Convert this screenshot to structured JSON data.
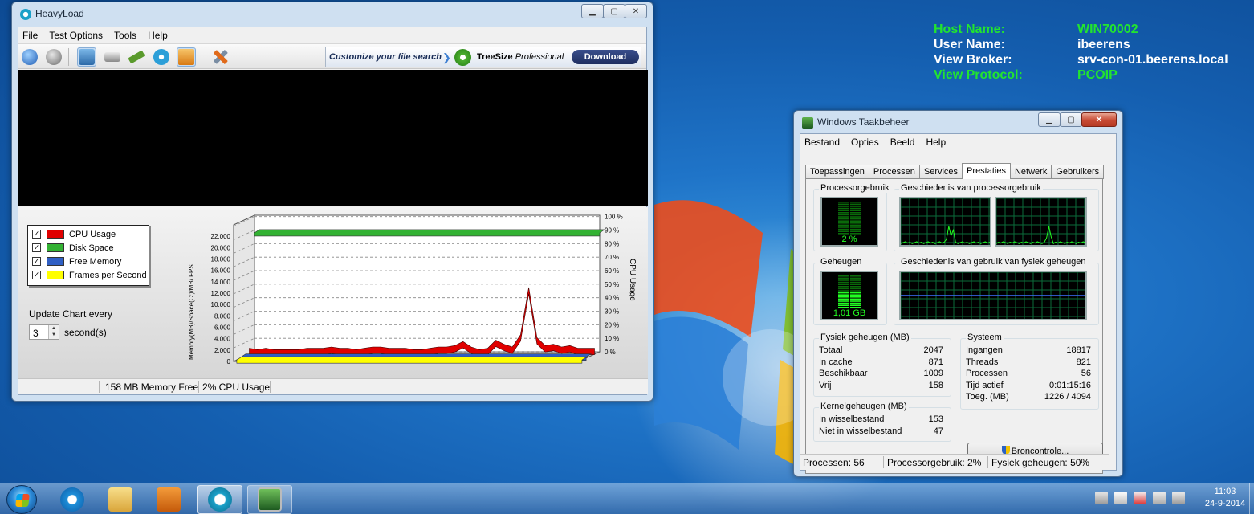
{
  "desktop": {
    "bginfo": [
      {
        "label": "Host Name:",
        "value": "WIN70002",
        "highlight": true
      },
      {
        "label": "User Name:",
        "value": "ibeerens",
        "highlight": false
      },
      {
        "label": "View Broker:",
        "value": "srv-con-01.beerens.local",
        "highlight": false
      },
      {
        "label": "View Protocol:",
        "value": "PCOIP",
        "highlight": true
      }
    ]
  },
  "heavyload": {
    "title": "HeavyLoad",
    "menu": [
      "File",
      "Test Options",
      "Tools",
      "Help"
    ],
    "toolbar_icons": [
      "play-icon",
      "stop-icon",
      "cpu-icon",
      "disk-icon",
      "memory-icon",
      "treesize-icon",
      "gpu-icon",
      "settings-icon"
    ],
    "ad": {
      "text": "Customize your file search",
      "brand_bold": "TreeSize",
      "brand_italic": "Professional",
      "button": "Download"
    },
    "legend": [
      {
        "label": "CPU Usage",
        "color": "#e00000",
        "checked": "✓"
      },
      {
        "label": "Disk Space",
        "color": "#33b233",
        "checked": "✓"
      },
      {
        "label": "Free Memory",
        "color": "#2f5fc4",
        "checked": "✓"
      },
      {
        "label": "Frames per Second",
        "color": "#ffff00",
        "checked": "✓"
      }
    ],
    "update_label": "Update Chart every",
    "update_value": "3",
    "update_unit": "second(s)",
    "status": {
      "memory": "158 MB Memory Free",
      "cpu": "2% CPU Usage"
    }
  },
  "chart_data": {
    "type": "area",
    "title": "",
    "ylabel_left": "Memory(MB)/Space(C:)/MB/ FPS",
    "ylabel_right": "CPU Usage",
    "left_ticks": [
      "0",
      "2.000",
      "4.000",
      "6.000",
      "8.000",
      "10.000",
      "12.000",
      "14.000",
      "16.000",
      "18.000",
      "20.000",
      "22.000"
    ],
    "right_ticks": [
      "0 %",
      "10 %",
      "20 %",
      "30 %",
      "40 %",
      "50 %",
      "60 %",
      "70 %",
      "80 %",
      "90 %",
      "100 %"
    ],
    "ylim_left": [
      0,
      24000
    ],
    "ylim_right": [
      0,
      100
    ],
    "series": [
      {
        "name": "CPU Usage",
        "axis": "right",
        "values": [
          2,
          1,
          2,
          1,
          1,
          1,
          1,
          2,
          2,
          2,
          3,
          2,
          2,
          1,
          2,
          3,
          3,
          2,
          2,
          2,
          1,
          1,
          2,
          3,
          3,
          4,
          7,
          3,
          1,
          2,
          8,
          5,
          3,
          12,
          47,
          10,
          4,
          5,
          3,
          4,
          2,
          2,
          2
        ]
      },
      {
        "name": "Disk Space",
        "axis": "right",
        "values": [
          88,
          88,
          88,
          88,
          88,
          88,
          88,
          88,
          88,
          88,
          88,
          88,
          88,
          88,
          88,
          88,
          88,
          88,
          88,
          88,
          88,
          88,
          88,
          88,
          88,
          88,
          88,
          88,
          88,
          88,
          88,
          88,
          88,
          88,
          88,
          88,
          88,
          88,
          88,
          88,
          88,
          88,
          88
        ]
      },
      {
        "name": "Free Memory",
        "axis": "left",
        "values": [
          158,
          158,
          158,
          158,
          158,
          158,
          158,
          158,
          158,
          158,
          158,
          158,
          158,
          158,
          158,
          158,
          158,
          158,
          158,
          158,
          158,
          158,
          158,
          158,
          158,
          158,
          158,
          158,
          158,
          158,
          158,
          158,
          158,
          158,
          158,
          158,
          158,
          158,
          158,
          158,
          158,
          158,
          158
        ]
      },
      {
        "name": "Frames per Second",
        "axis": "left",
        "values": [
          0,
          0,
          0,
          0,
          0,
          0,
          0,
          0,
          0,
          0,
          0,
          0,
          0,
          0,
          0,
          0,
          0,
          0,
          0,
          0,
          0,
          0,
          0,
          0,
          0,
          0,
          0,
          0,
          0,
          0,
          0,
          0,
          0,
          0,
          0,
          0,
          0,
          0,
          0,
          0,
          0,
          0,
          0
        ]
      }
    ]
  },
  "taskmgr": {
    "title": "Windows Taakbeheer",
    "menu": [
      "Bestand",
      "Opties",
      "Beeld",
      "Help"
    ],
    "tabs": [
      "Toepassingen",
      "Processen",
      "Services",
      "Prestaties",
      "Netwerk",
      "Gebruikers"
    ],
    "selected_tab": "Prestaties",
    "cpu_label": "Processorgebruik",
    "cpu_value": "2 %",
    "cpu_level": 0.02,
    "cpu_history_label": "Geschiedenis van processorgebruik",
    "mem_label": "Geheugen",
    "mem_value": "1,01 GB",
    "mem_level": 0.5,
    "mem_history_label": "Geschiedenis van gebruik van fysiek geheugen",
    "physical": {
      "label": "Fysiek geheugen (MB)",
      "rows": [
        {
          "k": "Totaal",
          "v": "2047"
        },
        {
          "k": "In cache",
          "v": "871"
        },
        {
          "k": "Beschikbaar",
          "v": "1009"
        },
        {
          "k": "Vrij",
          "v": "158"
        }
      ]
    },
    "system": {
      "label": "Systeem",
      "rows": [
        {
          "k": "Ingangen",
          "v": "18817"
        },
        {
          "k": "Threads",
          "v": "821"
        },
        {
          "k": "Processen",
          "v": "56"
        },
        {
          "k": "Tijd actief",
          "v": "0:01:15:16"
        },
        {
          "k": "Toeg. (MB)",
          "v": "1226 / 4094"
        }
      ]
    },
    "kernel": {
      "label": "Kernelgeheugen (MB)",
      "rows": [
        {
          "k": "In wisselbestand",
          "v": "153"
        },
        {
          "k": "Niet in wisselbestand",
          "v": "47"
        }
      ]
    },
    "resource_button": "Broncontrole...",
    "status": {
      "procs": "Processen: 56",
      "cpu": "Processorgebruik: 2%",
      "mem": "Fysiek geheugen: 50%"
    }
  },
  "taskbar": {
    "apps": [
      "internet-explorer-icon",
      "explorer-icon",
      "media-player-icon",
      "heavyload-icon",
      "taskmgr-icon"
    ],
    "tray": [
      "keyboard-icon",
      "show-hidden-icon",
      "action-center-icon",
      "network-icon",
      "volume-icon"
    ],
    "time": "11:03",
    "date": "24-9-2014"
  }
}
